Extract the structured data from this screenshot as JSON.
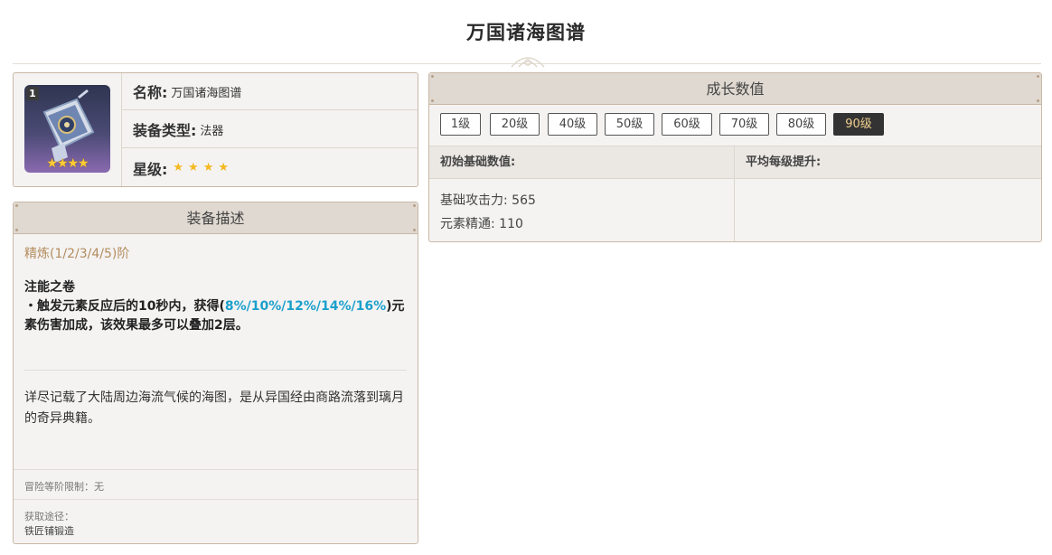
{
  "page": {
    "title": "万国诸海图谱"
  },
  "info": {
    "level_badge": "1",
    "image_stars": "★★★★",
    "name_key": "名称:",
    "name_value": "万国诸海图谱",
    "type_key": "装备类型:",
    "type_value": "法器",
    "rarity_key": "星级:",
    "rarity_stars": "★★★★"
  },
  "description": {
    "header": "装备描述",
    "refine": "精炼(1/2/3/4/5)阶",
    "passive_name": "注能之卷",
    "passive_prefix": "・触发元素反应后的10秒内，获得(",
    "passive_values": "8%/10%/12%/14%/16%",
    "passive_suffix": ")元素伤害加成，该效果最多可以叠加2层。",
    "lore": "详尽记载了大陆周边海流气候的海图，是从异国经由商路流落到璃月的奇异典籍。",
    "limit": "冒险等阶限制：无",
    "source_label": "获取途径：",
    "source_value": "铁匠铺锻造"
  },
  "growth": {
    "header": "成长数值",
    "levels": [
      "1级",
      "20级",
      "40级",
      "50级",
      "60级",
      "70级",
      "80级",
      "90级"
    ],
    "selected_level": "90级",
    "col_base": "初始基础数值:",
    "col_avg": "平均每级提升:",
    "stats": [
      "基础攻击力: 565",
      "元素精通: 110"
    ]
  },
  "colors": {
    "accent_gold": "#f0cf8e",
    "highlight_blue": "#1ba0cc",
    "refine_brown": "#b48c5e",
    "star_yellow": "#f5b820"
  }
}
